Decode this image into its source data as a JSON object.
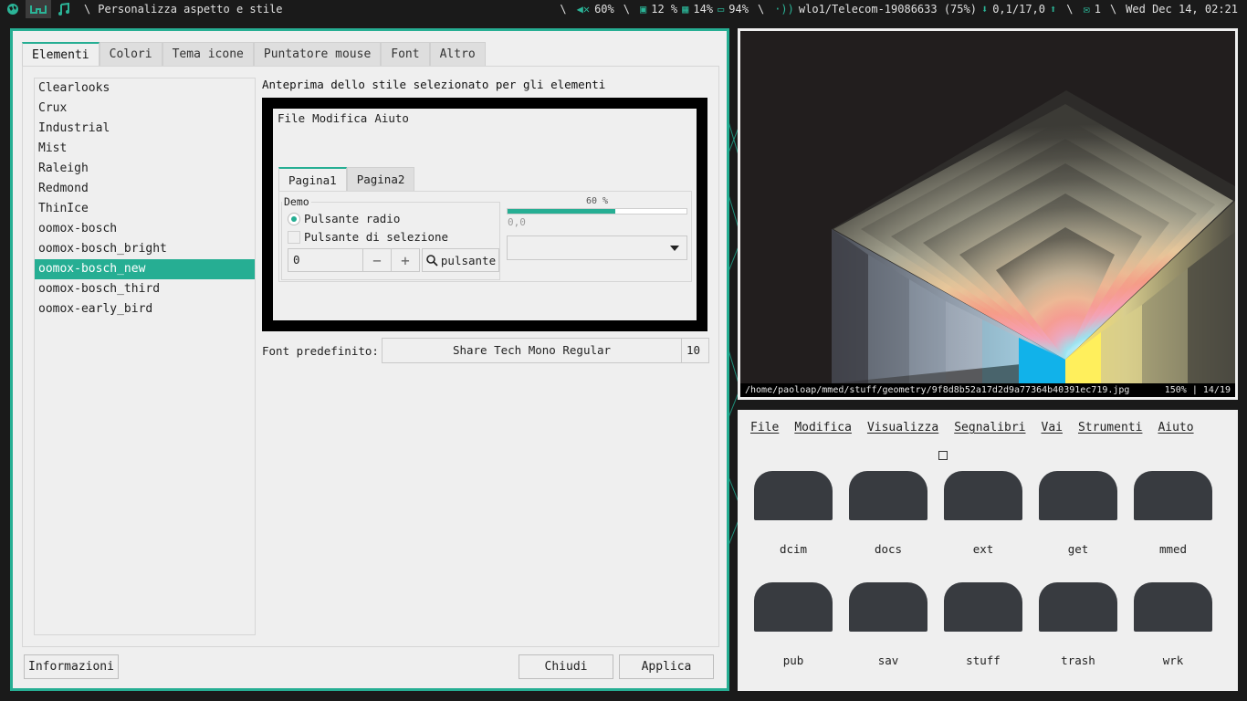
{
  "topbar": {
    "window_title": "Personalizza aspetto e stile",
    "volume": "60%",
    "cpu": "12 %",
    "memory": "14%",
    "battery": "94%",
    "network": "wlo1/Telecom-19086633 (75%)",
    "net_speed": "0,1/17,0",
    "mail": "1",
    "datetime": "Wed Dec 14, 02:21",
    "accent": "#2bb497"
  },
  "settings": {
    "tabs": [
      "Elementi",
      "Colori",
      "Tema icone",
      "Puntatore mouse",
      "Font",
      "Altro"
    ],
    "active_tab": "Elementi",
    "themes": [
      "Clearlooks",
      "Crux",
      "Industrial",
      "Mist",
      "Raleigh",
      "Redmond",
      "ThinIce",
      "oomox-bosch",
      "oomox-bosch_bright",
      "oomox-bosch_new",
      "oomox-bosch_third",
      "oomox-early_bird"
    ],
    "selected_theme": "oomox-bosch_new",
    "preview_label": "Anteprima dello stile selezionato per gli elementi",
    "preview": {
      "menu": [
        "File",
        "Modifica",
        "Aiuto"
      ],
      "tabs": [
        "Pagina1",
        "Pagina2"
      ],
      "demo_label": "Demo",
      "radio_label": "Pulsante radio",
      "check_label": "Pulsante di selezione",
      "spin_value": "0",
      "spin_minus": "−",
      "spin_plus": "+",
      "button_label": "pulsante",
      "progress_text": "60 %",
      "progress_fraction": 0.6,
      "scale_value": "0,0"
    },
    "font_label": "Font predefinito:",
    "font_name": "Share Tech Mono Regular",
    "font_size": "10",
    "buttons": {
      "info": "Informazioni",
      "close": "Chiudi",
      "apply": "Applica"
    },
    "accent": "#26ae93"
  },
  "viewer": {
    "path": "/home/paoloap/mmed/stuff/geometry/9f8d8b52a17d2d9a77364b40391ec719.jpg",
    "zoom_index": "150% | 14/19"
  },
  "files": {
    "menu": [
      "File",
      "Modifica",
      "Visualizza",
      "Segnalibri",
      "Vai",
      "Strumenti",
      "Aiuto"
    ],
    "folders": [
      "dcim",
      "docs",
      "ext",
      "get",
      "mmed",
      "pub",
      "sav",
      "stuff",
      "trash",
      "wrk"
    ]
  }
}
